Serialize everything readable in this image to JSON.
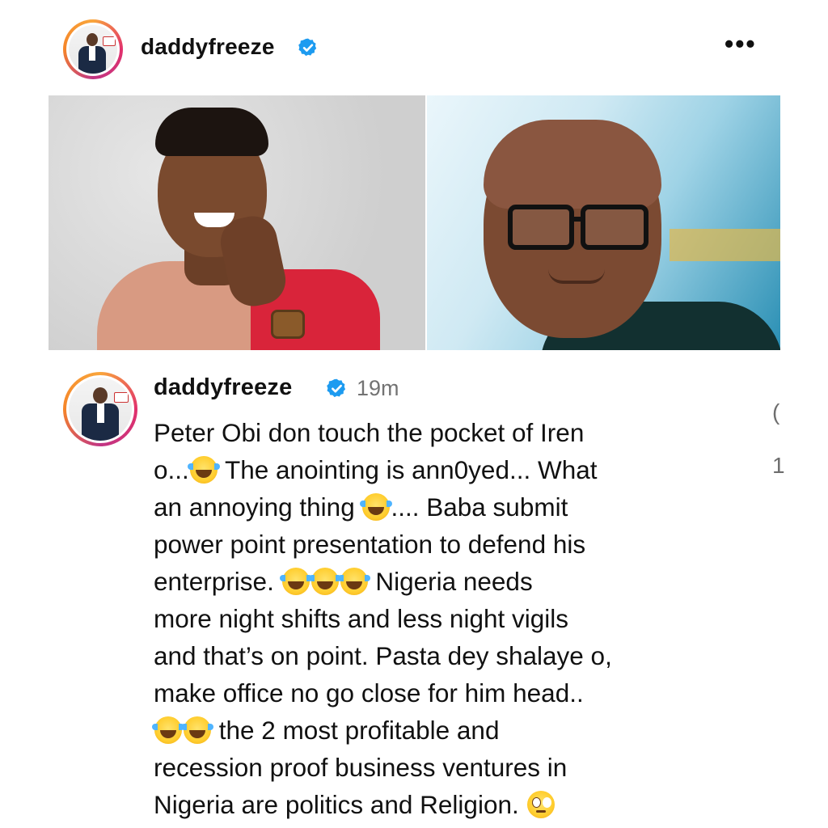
{
  "post": {
    "username": "daddyfreeze",
    "more_label": "•••"
  },
  "comment": {
    "username": "daddyfreeze",
    "time": "19m",
    "lines": [
      [
        "Peter Obi don touch the pocket of Iren"
      ],
      [
        "o...",
        "laugh",
        " The anointing is ann0yed... What"
      ],
      [
        "an annoying thing ",
        "laugh",
        ".... Baba submit"
      ],
      [
        "power point presentation to defend his"
      ],
      [
        "enterprise. ",
        "laugh",
        "laugh",
        "laugh",
        " Nigeria needs"
      ],
      [
        "more night shifts and less night vigils"
      ],
      [
        "and that’s on point. Pasta dey shalaye o,"
      ],
      [
        "make office no go close for him head.."
      ],
      [
        "laugh",
        "laugh",
        " the 2 most profitable and"
      ],
      [
        "recession proof business ventures in"
      ],
      [
        "Nigeria are politics and Religion. ",
        "eyes"
      ]
    ]
  },
  "side": {
    "top_glyph": "(",
    "count": "1"
  },
  "icons": {
    "verified": "verified-badge-icon",
    "more": "more-options-icon",
    "laugh": "tears-of-joy-emoji",
    "eyes": "face-with-rolling-eyes-emoji"
  },
  "colors": {
    "verified": "#1d9bf0",
    "ring": "#e1306c",
    "time": "#737373"
  }
}
